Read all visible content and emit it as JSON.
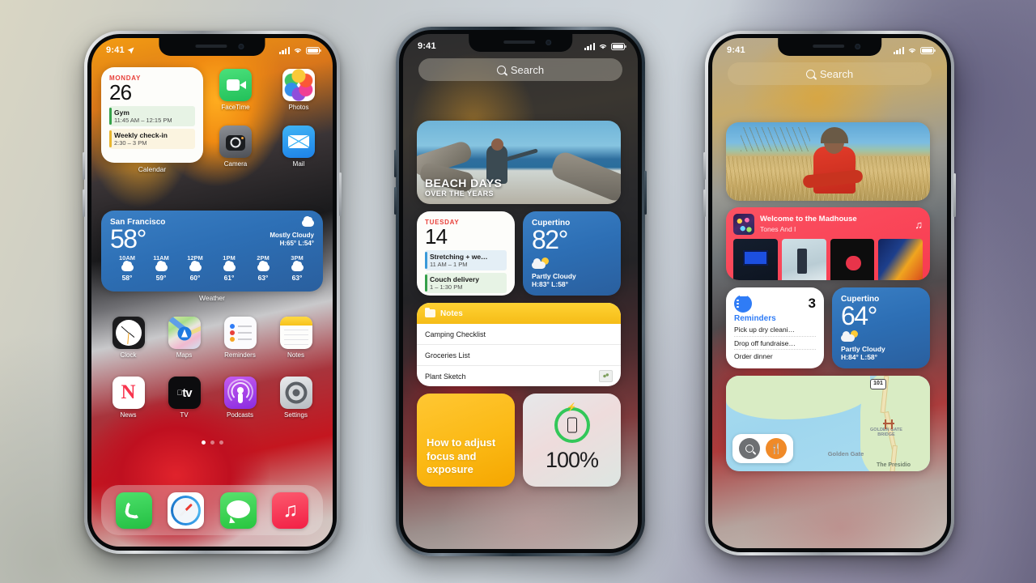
{
  "phones": [
    {
      "id": "phone-1",
      "status": {
        "time": "9:41",
        "location_icon": "location-arrow-icon",
        "signal_icon": "cellular-signal-icon",
        "wifi_icon": "wifi-icon",
        "battery_icon": "battery-icon"
      },
      "calendar_widget": {
        "weekday": "MONDAY",
        "day": "26",
        "events": [
          {
            "title": "Gym",
            "time": "11:45 AM – 12:15 PM",
            "color": "green"
          },
          {
            "title": "Weekly check-in",
            "time": "2:30 – 3 PM",
            "color": "yellow"
          }
        ],
        "label": "Calendar"
      },
      "apps_row1": [
        {
          "name": "FaceTime",
          "icon": "facetime-icon"
        },
        {
          "name": "Photos",
          "icon": "photos-icon"
        }
      ],
      "apps_row2": [
        {
          "name": "Camera",
          "icon": "camera-icon"
        },
        {
          "name": "Mail",
          "icon": "mail-icon"
        }
      ],
      "weather_widget": {
        "city": "San Francisco",
        "temp": "58°",
        "condition": "Mostly Cloudy",
        "highlow": "H:65° L:54°",
        "hourly": [
          {
            "time": "10AM",
            "temp": "58°"
          },
          {
            "time": "11AM",
            "temp": "59°"
          },
          {
            "time": "12PM",
            "temp": "60°"
          },
          {
            "time": "1PM",
            "temp": "61°"
          },
          {
            "time": "2PM",
            "temp": "63°"
          },
          {
            "time": "3PM",
            "temp": "63°"
          }
        ],
        "label": "Weather"
      },
      "apps_row3": [
        {
          "name": "Clock",
          "icon": "clock-icon"
        },
        {
          "name": "Maps",
          "icon": "maps-icon"
        },
        {
          "name": "Reminders",
          "icon": "reminders-icon"
        },
        {
          "name": "Notes",
          "icon": "notes-icon"
        }
      ],
      "apps_row4": [
        {
          "name": "News",
          "icon": "news-icon"
        },
        {
          "name": "TV",
          "icon": "appletv-icon"
        },
        {
          "name": "Podcasts",
          "icon": "podcasts-icon"
        },
        {
          "name": "Settings",
          "icon": "settings-icon"
        }
      ],
      "page_dots": {
        "count": 3,
        "active_index": 0
      },
      "dock": [
        {
          "name": "Phone",
          "icon": "phone-icon"
        },
        {
          "name": "Safari",
          "icon": "safari-icon"
        },
        {
          "name": "Messages",
          "icon": "messages-icon"
        },
        {
          "name": "Music",
          "icon": "music-icon"
        }
      ]
    },
    {
      "id": "phone-2",
      "status": {
        "time": "9:41",
        "signal_icon": "cellular-signal-icon",
        "wifi_icon": "wifi-icon",
        "battery_icon": "battery-icon"
      },
      "search": {
        "placeholder": "Search",
        "icon": "search-icon"
      },
      "photos_widget": {
        "title": "BEACH DAYS",
        "subtitle": "OVER THE YEARS"
      },
      "calendar_widget": {
        "weekday": "TUESDAY",
        "day": "14",
        "events": [
          {
            "title": "Stretching + we…",
            "time": "11 AM – 1 PM",
            "color": "blue"
          },
          {
            "title": "Couch delivery",
            "time": "1 – 1:30 PM",
            "color": "green"
          }
        ]
      },
      "weather_widget": {
        "city": "Cupertino",
        "temp": "82°",
        "condition": "Partly Cloudy",
        "highlow": "H:83° L:58°"
      },
      "notes_widget": {
        "header": "Notes",
        "folder_icon": "folder-icon",
        "rows": [
          "Camping Checklist",
          "Groceries List",
          "Plant Sketch"
        ]
      },
      "tips_widget": {
        "text": "How to adjust focus and exposure"
      },
      "battery_widget": {
        "percent": "100%",
        "charging_icon": "bolt-icon",
        "device_icon": "iphone-icon"
      }
    },
    {
      "id": "phone-3",
      "status": {
        "time": "9:41",
        "signal_icon": "cellular-signal-icon",
        "wifi_icon": "wifi-icon",
        "battery_icon": "battery-icon"
      },
      "search": {
        "placeholder": "Search",
        "icon": "search-icon"
      },
      "music_widget": {
        "title": "Welcome to the Madhouse",
        "artist": "Tones And I",
        "note_icon": "music-note-icon",
        "albums": [
          "album-art-1",
          "album-art-2",
          "album-art-3",
          "album-art-4"
        ]
      },
      "reminders_widget": {
        "icon": "reminders-list-icon",
        "count": "3",
        "title": "Reminders",
        "rows": [
          "Pick up dry cleani…",
          "Drop off fundraise…",
          "Order dinner"
        ]
      },
      "weather_widget": {
        "city": "Cupertino",
        "temp": "64°",
        "condition": "Partly Cloudy",
        "highlow": "H:84° L:58°"
      },
      "maps_widget": {
        "search_icon": "search-icon",
        "food_icon": "restaurant-icon",
        "route_shield": "101",
        "landmark": "GOLDEN GATE BRIDGE",
        "place_1": "Golden Gate",
        "place_2": "The Presidio"
      }
    }
  ],
  "colors": {
    "ios_blue": "#2f7cf6",
    "ios_green": "#33c759",
    "ios_red": "#e8403a",
    "ios_yellow": "#f5bc17",
    "music_red": "#f83b50",
    "weather_blue": "#2d6fb5"
  }
}
